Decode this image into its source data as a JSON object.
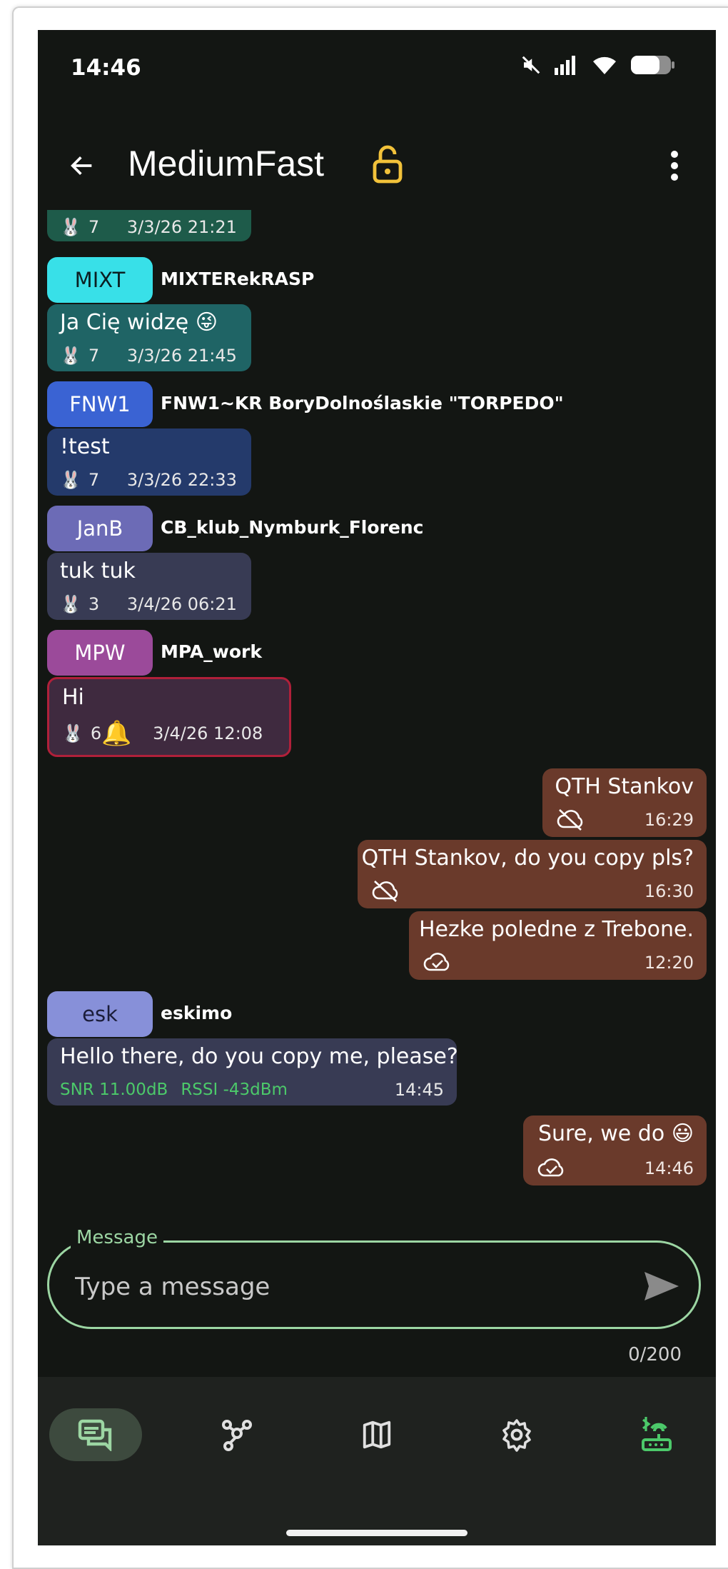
{
  "status": {
    "time": "14:46"
  },
  "header": {
    "title": "MediumFast"
  },
  "colors": {
    "accent": "#9cd6a3",
    "lock": "#f2c23a",
    "outgoing_bubble": "#6a3a2b",
    "snr_rssi": "#4cc96a"
  },
  "messages": {
    "m0": {
      "hops": "7",
      "time": "3/3/26 21:21"
    },
    "m1": {
      "avatar": "MIXT",
      "sender": "MIXTERekRASP",
      "text": "Ja Cię widzę 😜",
      "hops": "7",
      "time": "3/3/26 21:45"
    },
    "m2": {
      "avatar": "FNW1",
      "sender": "FNW1~KR BoryDolnoślaskie \"TORPEDO\"",
      "text": "!test",
      "hops": "7",
      "time": "3/3/26 22:33"
    },
    "m3": {
      "avatar": "JanB",
      "sender": "CB_klub_Nymburk_Florenc",
      "text": "tuk tuk",
      "hops": "3",
      "time": "3/4/26 06:21"
    },
    "m4": {
      "avatar": "MPW",
      "sender": "MPA_work",
      "text": "Hi",
      "hops": "6",
      "time": "3/4/26 12:08"
    },
    "m5": {
      "text": "QTH Stankov",
      "time": "16:29"
    },
    "m6": {
      "text": "QTH Stankov, do you copy pls?",
      "time": "16:30"
    },
    "m7": {
      "text": "Hezke poledne z Trebone.",
      "time": "12:20"
    },
    "m8": {
      "avatar": "esk",
      "sender": "eskimo",
      "text": "Hello there, do you copy me, please?",
      "snr": "SNR 11.00dB",
      "rssi": "RSSI -43dBm",
      "time": "14:45"
    },
    "m9": {
      "text": "Sure, we do 😃",
      "time": "14:46"
    }
  },
  "composer": {
    "label": "Message",
    "placeholder": "Type a message",
    "counter": "0/200"
  },
  "nav": [
    "conversations-icon",
    "nodes-icon",
    "map-icon",
    "settings-icon",
    "bluetooth-router-icon"
  ]
}
